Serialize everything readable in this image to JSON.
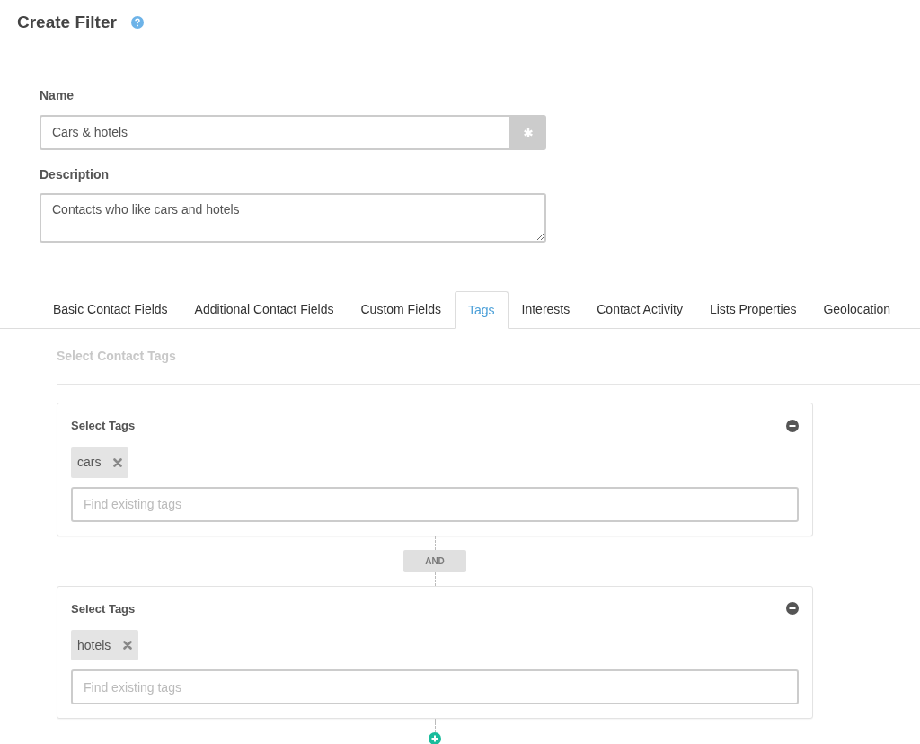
{
  "header": {
    "title": "Create Filter"
  },
  "form": {
    "name": {
      "label": "Name",
      "value": "Cars & hotels"
    },
    "description": {
      "label": "Description",
      "value": "Contacts who like cars and hotels"
    }
  },
  "tabs": [
    {
      "label": "Basic Contact Fields",
      "selected": false
    },
    {
      "label": "Additional Contact Fields",
      "selected": false
    },
    {
      "label": "Custom Fields",
      "selected": false
    },
    {
      "label": "Tags",
      "selected": true
    },
    {
      "label": "Interests",
      "selected": false
    },
    {
      "label": "Contact Activity",
      "selected": false
    },
    {
      "label": "Lists Properties",
      "selected": false
    },
    {
      "label": "Geolocation",
      "selected": false
    }
  ],
  "panel": {
    "heading": "Select Contact Tags",
    "groups": [
      {
        "title": "Select Tags",
        "tags": [
          "cars"
        ],
        "search": {
          "placeholder": "Find existing tags"
        }
      },
      {
        "title": "Select Tags",
        "tags": [
          "hotels"
        ],
        "search": {
          "placeholder": "Find existing tags"
        }
      }
    ],
    "connectors": [
      "AND"
    ]
  }
}
